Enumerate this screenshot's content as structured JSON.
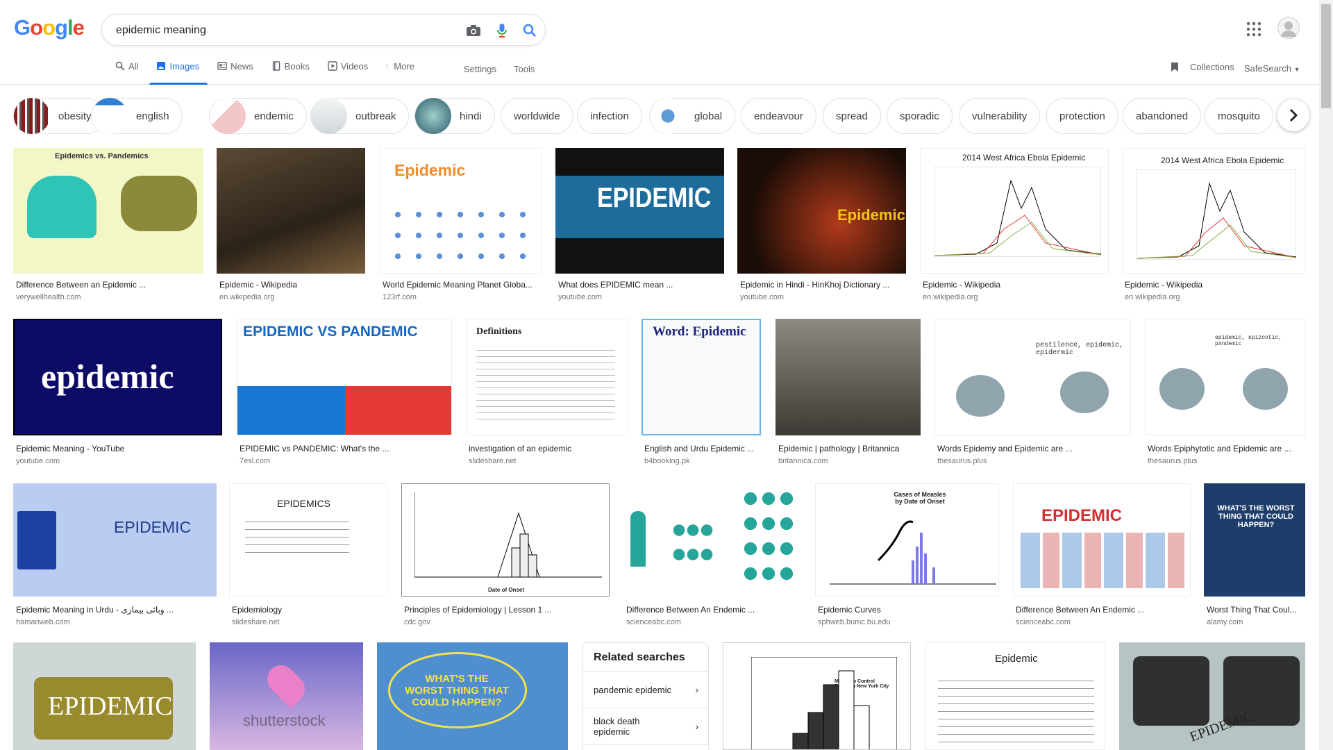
{
  "logo": {
    "text": "Google"
  },
  "search": {
    "query": "epidemic meaning"
  },
  "tabs": [
    {
      "label": "All",
      "icon": "search-icon"
    },
    {
      "label": "Images",
      "icon": "image-icon",
      "active": true
    },
    {
      "label": "News",
      "icon": "news-icon"
    },
    {
      "label": "Books",
      "icon": "book-icon"
    },
    {
      "label": "Videos",
      "icon": "video-icon"
    },
    {
      "label": "More",
      "icon": "more-vert-icon"
    }
  ],
  "settings_label": "Settings",
  "tools_label": "Tools",
  "collections_label": "Collections",
  "safesearch_label": "SafeSearch",
  "chips": [
    "obesity",
    "english",
    "endemic",
    "outbreak",
    "hindi",
    "worldwide",
    "infection",
    "global",
    "endeavour",
    "spread",
    "sporadic",
    "vulnerability",
    "protection",
    "abandoned",
    "mosquito"
  ],
  "results": [
    {
      "title": "Difference Between an Epidemic ...",
      "source": "verywellhealth.com",
      "img_text": "Epidemics vs. Pandemics"
    },
    {
      "title": "Epidemic - Wikipedia",
      "source": "en.wikipedia.org",
      "img_text": ""
    },
    {
      "title": "World Epidemic Meaning Planet Globa...",
      "source": "123rf.com",
      "img_text": "Epidemic"
    },
    {
      "title": "What does EPIDEMIC mean ...",
      "source": "youtube.com",
      "img_text": "EPIDEMIC"
    },
    {
      "title": "Epidemic in Hindi - HinKhoj Dictionary ...",
      "source": "youtube.com",
      "img_text": "Epidemic"
    },
    {
      "title": "Epidemic - Wikipedia",
      "source": "en.wikipedia.org",
      "img_text": "2014 West Africa Ebola Epidemic"
    },
    {
      "title": "Epidemic - Wikipedia",
      "source": "en.wikipedia.org",
      "img_text": "2014 West Africa Ebola Epidemic"
    },
    {
      "title": "Epidemic Meaning - YouTube",
      "source": "youtube.com",
      "img_text": "epidemic"
    },
    {
      "title": "EPIDEMIC vs PANDEMIC: What's the ...",
      "source": "7esl.com",
      "img_text": "EPIDEMIC VS PANDEMIC"
    },
    {
      "title": "investigation of an epidemic",
      "source": "slideshare.net",
      "img_text": "Definitions"
    },
    {
      "title": "English and Urdu Epidemic ...",
      "source": "b4booking.pk",
      "img_text": "Word: Epidemic"
    },
    {
      "title": "Epidemic | pathology | Britannica",
      "source": "britannica.com",
      "img_text": ""
    },
    {
      "title": "Words Epidemy and Epidemic are ...",
      "source": "thesaurus.plus",
      "img_text": "pestilence, epidemic, epidermic"
    },
    {
      "title": "Words Epiphytotic and Epidemic are ...",
      "source": "thesaurus.plus",
      "img_text": "epidemic, epizootic, pandemic"
    },
    {
      "title": "Epidemic Meaning in Urdu - وبائی بیماری ...",
      "source": "hamariweb.com",
      "img_text": "EPIDEMIC"
    },
    {
      "title": "Epidemiology",
      "source": "slideshare.net",
      "img_text": "EPIDEMICS"
    },
    {
      "title": "Principles of Epidemiology | Lesson 1 ...",
      "source": "cdc.gov",
      "img_text": "Date of Onset"
    },
    {
      "title": "Difference Between An Endemic ...",
      "source": "scienceabc.com",
      "img_text": ""
    },
    {
      "title": "Epidemic Curves",
      "source": "sphweb.bumc.bu.edu",
      "img_text": "Cases of Measles by Date of Onset"
    },
    {
      "title": "Difference Between An Endemic ...",
      "source": "scienceabc.com",
      "img_text": "EPIDEMIC"
    },
    {
      "title": "Worst Thing That Coul...",
      "source": "alamy.com",
      "img_text": "WHAT'S THE WORST THING THAT COULD HAPPEN?"
    },
    {
      "title": "",
      "source": "",
      "img_text": "EPIDEMIC"
    },
    {
      "title": "",
      "source": "",
      "img_text": "shutterstock"
    },
    {
      "title": "",
      "source": "",
      "img_text": "WHAT'S THE WORST THING THAT COULD HAPPEN?"
    },
    {
      "title": "",
      "source": "",
      "img_text": "Mosquito Control Begun in New York City"
    },
    {
      "title": "",
      "source": "",
      "img_text": "Epidemic"
    },
    {
      "title": "",
      "source": "",
      "img_text": "EPIDEMIC"
    }
  ],
  "related": {
    "heading": "Related searches",
    "items": [
      "pandemic epidemic",
      "black death epidemic"
    ]
  }
}
